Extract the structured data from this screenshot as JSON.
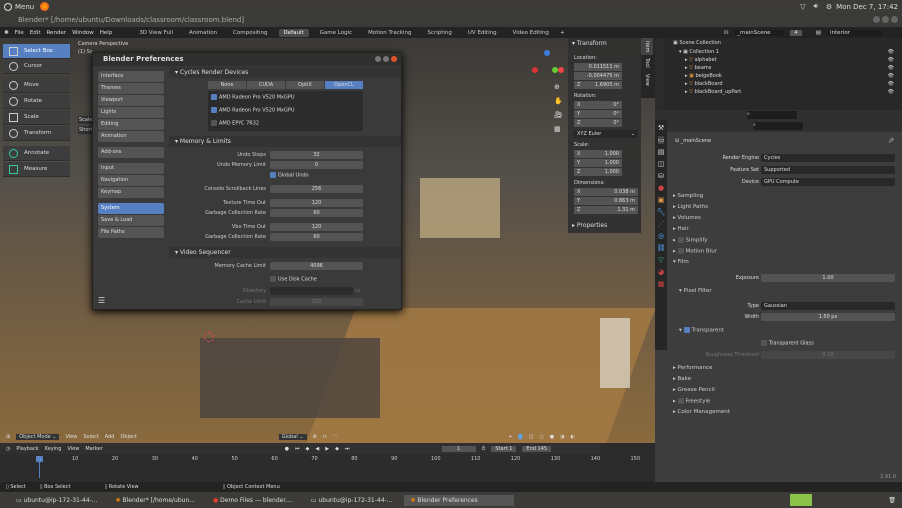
{
  "os": {
    "menu": "Menu",
    "clock": "Mon Dec  7, 17:42"
  },
  "window_title": "Blender* [/home/ubuntu/Downloads/classroom/classroom.blend]",
  "menus": [
    "File",
    "Edit",
    "Render",
    "Window",
    "Help"
  ],
  "workspaces": [
    "3D View Full",
    "Animation",
    "Compositing",
    "Default",
    "Game Logic",
    "Motion Tracking",
    "Scripting",
    "UV Editing",
    "Video Editing"
  ],
  "scene": {
    "name": "_mainScene",
    "users": "4",
    "view_layer": "interior"
  },
  "viewport": {
    "camera": "Camera Perspective",
    "object": "(1) Sc",
    "scale_popup": "Scale",
    "shortcut": "Short"
  },
  "tools": [
    "Select Box",
    "Cursor",
    "Move",
    "Rotate",
    "Scale",
    "Transform",
    "Annotate",
    "Measure"
  ],
  "prefs": {
    "title": "Blender Preferences",
    "categories": [
      "Interface",
      "Themes",
      "Viewport",
      "Lights",
      "Editing",
      "Animation",
      "Add-ons",
      "Input",
      "Navigation",
      "Keymap",
      "System",
      "Save & Load",
      "File Paths"
    ],
    "cycles_header": "Cycles Render Devices",
    "device_tabs": [
      "None",
      "CUDA",
      "OptiX",
      "OpenCL"
    ],
    "devices": [
      {
        "name": "AMD Radeon Pro V520  MxGPU",
        "on": true
      },
      {
        "name": "AMD Radeon Pro V520  MxGPU",
        "on": true
      },
      {
        "name": "AMD EPYC 7R32",
        "on": false
      }
    ],
    "memory_header": "Memory & Limits",
    "undo_steps_label": "Undo Steps",
    "undo_steps": "32",
    "undo_mem_label": "Undo Memory Limit",
    "undo_mem": "0",
    "global_undo": "Global Undo",
    "console_label": "Console Scrollback Lines",
    "console": "256",
    "tex_timeout_label": "Texture Time Out",
    "tex_timeout": "120",
    "gc_label": "Garbage Collection Rate",
    "gc": "60",
    "vbo_label": "Vbo Time Out",
    "vbo": "120",
    "gc2": "60",
    "vse_header": "Video Sequencer",
    "mem_cache_label": "Memory Cache Limit",
    "mem_cache": "4096",
    "disk_cache": "Use Disk Cache",
    "dir_label": "Directory",
    "cache_limit_label": "Cache Limit",
    "cache_limit": "100"
  },
  "transform": {
    "header": "Transform",
    "location": "Location:",
    "loc": [
      "0.011511 m",
      "-0.004475 m",
      "1.6905 m"
    ],
    "rotation": "Rotation:",
    "rot": [
      "0°",
      "0°",
      "0°"
    ],
    "euler": "XYZ Euler",
    "scale": "Scale:",
    "scl": [
      "1.000",
      "1.000",
      "1.000"
    ],
    "dimensions": "Dimensions:",
    "dim": [
      "0.038 m",
      "0.863 m",
      "1.31 m"
    ],
    "axes": [
      "X",
      "Y",
      "Z"
    ],
    "properties": "Properties",
    "tabs": [
      "Item",
      "Tool",
      "View"
    ]
  },
  "outliner": {
    "root": "Scene Collection",
    "collection": "Collection 1",
    "items": [
      "alphabet",
      "beams",
      "beigeBook",
      "blackBoard",
      "blackBoard_upPart"
    ]
  },
  "properties": {
    "scene": "_mainScene",
    "engine_label": "Render Engine",
    "engine": "Cycles",
    "feature_label": "Feature Set",
    "feature": "Supported",
    "device_label": "Device",
    "device": "GPU Compute",
    "panels1": [
      "Sampling",
      "Light Paths",
      "Volumes",
      "Hair",
      "Simplify",
      "Motion Blur",
      "Film"
    ],
    "exposure_label": "Exposure",
    "exposure": "1.00",
    "pixel_filter": "Pixel Filter",
    "type_label": "Type",
    "type": "Gaussian",
    "width_label": "Width",
    "width": "1.50 px",
    "transparent": "Transparent",
    "transparent_glass": "Transparent Glass",
    "rough_label": "Roughness Threshold",
    "rough": "0.10",
    "panels2": [
      "Performance",
      "Bake",
      "Grease Pencil",
      "Freestyle",
      "Color Management"
    ]
  },
  "view_header": [
    "Object Mode",
    "View",
    "Select",
    "Add",
    "Object",
    "Global"
  ],
  "timeline": {
    "menus": [
      "Playback",
      "Keying",
      "View",
      "Marker"
    ],
    "current": "1",
    "start_label": "Start",
    "start": "1",
    "end_label": "End",
    "end": "145",
    "ticks": [
      "1",
      "10",
      "20",
      "30",
      "40",
      "50",
      "60",
      "70",
      "80",
      "90",
      "100",
      "110",
      "120",
      "130",
      "140",
      "150"
    ]
  },
  "status": [
    "Select",
    "Box Select",
    "Rotate View",
    "Object Context Menu"
  ],
  "version": "2.91.0",
  "taskbar": [
    "ubuntu@ip-172-31-44-...",
    "Blender* [/home/ubun...",
    "Demo Files — blender....",
    "ubuntu@ip-172-31-44-...",
    "Blender Preferences"
  ]
}
